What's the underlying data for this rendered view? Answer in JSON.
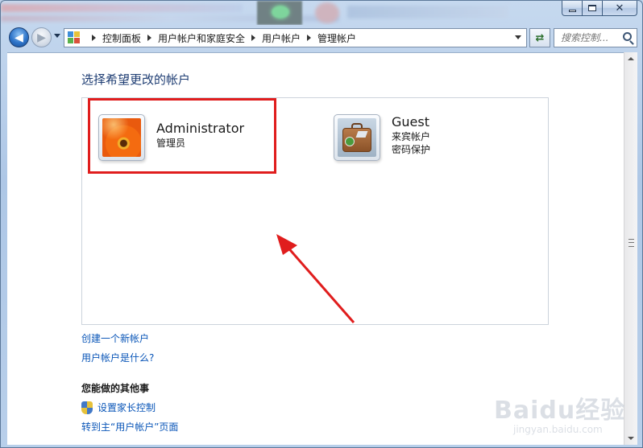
{
  "window": {
    "caption": {
      "minimize": "",
      "maximize": "",
      "close": "✕"
    }
  },
  "nav": {
    "breadcrumb": [
      "控制面板",
      "用户帐户和家庭安全",
      "用户帐户",
      "管理帐户"
    ],
    "search_placeholder": "搜索控制..."
  },
  "main": {
    "title": "选择希望更改的帐户",
    "accounts": [
      {
        "name": "Administrator",
        "details": [
          "管理员"
        ],
        "picture": "flower-picture"
      },
      {
        "name": "Guest",
        "details": [
          "来宾帐户",
          "密码保护"
        ],
        "picture": "suitcase-picture"
      }
    ],
    "links": [
      "创建一个新帐户",
      "用户帐户是什么?"
    ],
    "other_tasks_heading": "您能做的其他事",
    "tasks": [
      "设置家长控制",
      "转到主“用户帐户”页面"
    ]
  },
  "watermark": {
    "logo": "Baidu经验",
    "sub": "jingyan.baidu.com"
  },
  "colors": {
    "link": "#0a56b8",
    "title": "#1e3d73",
    "highlight": "#e01d1d"
  }
}
